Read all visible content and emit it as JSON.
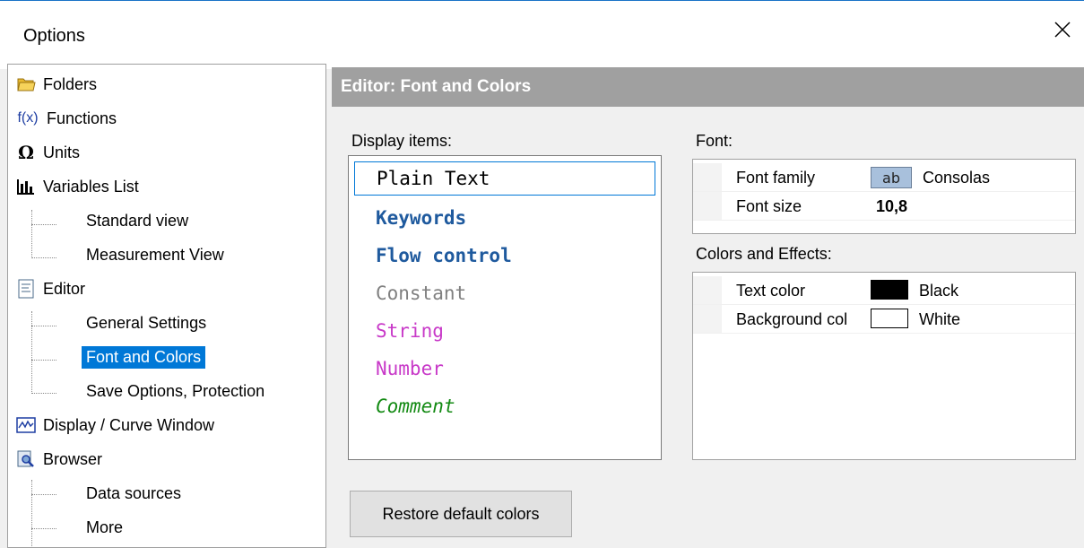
{
  "window": {
    "title": "Options"
  },
  "tree": {
    "items": [
      {
        "label": "Folders",
        "icon": "folder-icon",
        "level": 0
      },
      {
        "label": "Functions",
        "icon": "function-icon",
        "icon_text": "f(x)",
        "level": 0
      },
      {
        "label": "Units",
        "icon": "omega-icon",
        "icon_text": "Ω",
        "level": 0
      },
      {
        "label": "Variables List",
        "icon": "variables-list-icon",
        "level": 0
      },
      {
        "label": "Standard view",
        "level": 1
      },
      {
        "label": "Measurement View",
        "level": 1
      },
      {
        "label": "Editor",
        "icon": "editor-icon",
        "level": 0
      },
      {
        "label": "General Settings",
        "level": 1
      },
      {
        "label": "Font and Colors",
        "level": 1,
        "selected": true
      },
      {
        "label": "Save Options, Protection",
        "level": 1
      },
      {
        "label": "Display / Curve Window",
        "icon": "curve-window-icon",
        "level": 0
      },
      {
        "label": "Browser",
        "icon": "browser-icon",
        "level": 0
      },
      {
        "label": "Data sources",
        "level": 1
      },
      {
        "label": "More",
        "level": 1
      }
    ]
  },
  "panel": {
    "header": "Editor: Font and Colors",
    "display_items_label": "Display items:",
    "display_items": [
      {
        "label": "Plain Text",
        "color": "#000000",
        "bold": false,
        "italic": false
      },
      {
        "label": "Keywords",
        "color": "#1f5a9e",
        "bold": true,
        "italic": false
      },
      {
        "label": "Flow control",
        "color": "#1f5a9e",
        "bold": true,
        "italic": false
      },
      {
        "label": "Constant",
        "color": "#808080",
        "bold": false,
        "italic": false
      },
      {
        "label": "String",
        "color": "#c839c8",
        "bold": false,
        "italic": false
      },
      {
        "label": "Number",
        "color": "#c839c8",
        "bold": false,
        "italic": false
      },
      {
        "label": "Comment",
        "color": "#138a13",
        "bold": false,
        "italic": true
      }
    ],
    "font_label": "Font:",
    "font": {
      "family_label": "Font family",
      "family_sample": "ab",
      "family_value": "Consolas",
      "size_label": "Font size",
      "size_value": "10,8"
    },
    "colors_label": "Colors and Effects:",
    "colors": {
      "text_color_label": "Text color",
      "text_color_value": "Black",
      "text_color_hex": "#000000",
      "background_label": "Background col",
      "background_value": "White",
      "background_hex": "#ffffff"
    },
    "restore_button": "Restore default colors"
  }
}
